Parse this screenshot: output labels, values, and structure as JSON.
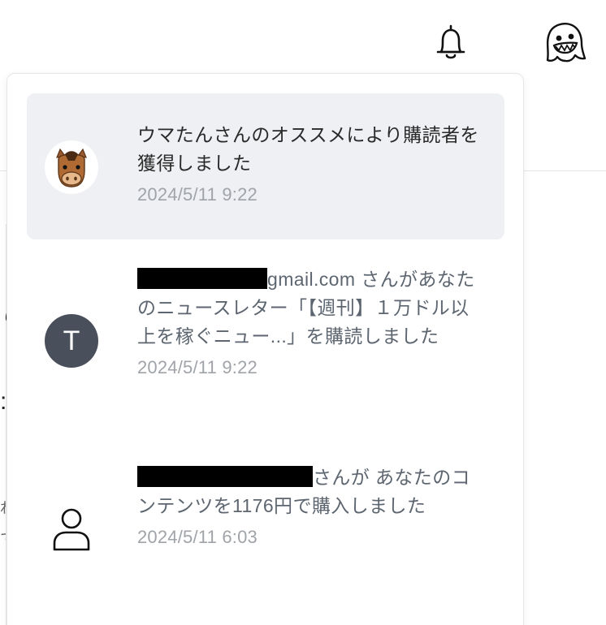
{
  "header": {
    "bell_icon": "bell-icon",
    "user_avatar_icon": "ghost-icon"
  },
  "background": {
    "glyph_1": "こ",
    "glyph_2": ":",
    "glyph_3": "ね",
    "glyph_4": "て"
  },
  "notifications": [
    {
      "avatar_icon": "horse-face-icon",
      "message": "ウマたんさんのオススメにより購読者を獲得しました",
      "timestamp": "2024/5/11 9:22",
      "state": "unread"
    },
    {
      "avatar_letter": "T",
      "message_suffix": "gmail.com さんがあなたのニュースレター「【週刊】１万ドル以上を稼ぐニュー...」を購読しました",
      "timestamp": "2024/5/11 9:22",
      "state": "read"
    },
    {
      "avatar_icon": "user-icon",
      "message_suffix": "さんが あなたのコンテンツを1176円で購入しました",
      "timestamp": "2024/5/11 6:03",
      "state": "read"
    }
  ],
  "colors": {
    "active_row_bg": "#eff0f3",
    "letter_avatar_bg": "#4a4f5c",
    "timestamp": "#a0a4a9",
    "read_text": "#5d6670"
  }
}
